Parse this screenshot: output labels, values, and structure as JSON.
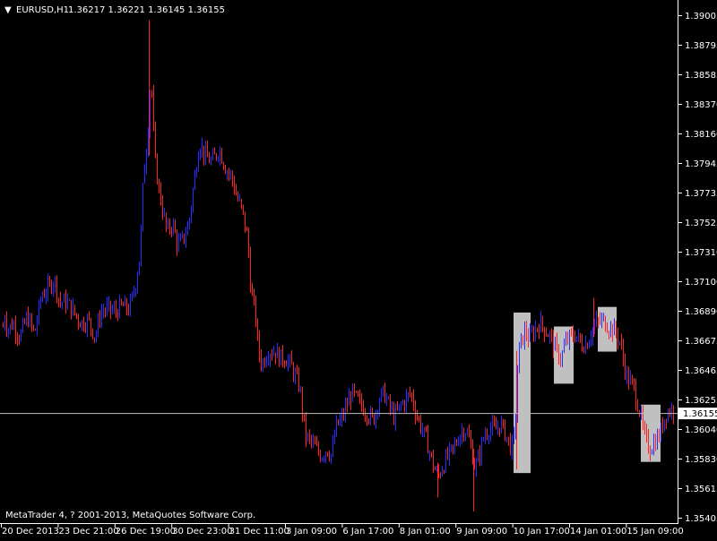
{
  "header": {
    "arrow_glyph": "▼",
    "symbol": "EURUSD,H1",
    "ohlc": "1.36217  1.36221  1.36145  1.36155"
  },
  "price_axis": {
    "labels": [
      "1.39005",
      "1.38795",
      "1.38585",
      "1.38370",
      "1.38160",
      "1.37945",
      "1.37735",
      "1.37525",
      "1.37310",
      "1.37100",
      "1.36890",
      "1.36675",
      "1.36465",
      "1.36255",
      "1.36040",
      "1.35830",
      "1.35615",
      "1.35405"
    ]
  },
  "time_axis": {
    "labels": [
      "20 Dec 2013",
      "23 Dec 21:00",
      "26 Dec 19:00",
      "30 Dec 23:00",
      "31 Dec 11:00",
      "3 Jan 09:00",
      "6 Jan 17:00",
      "8 Jan 01:00",
      "9 Jan 09:00",
      "10 Jan 17:00",
      "14 Jan 01:00",
      "15 Jan 09:00"
    ]
  },
  "bid_line": {
    "price": 1.36155,
    "label": "1.36155"
  },
  "copyright": "MetaTrader 4, ? 2001-2013, MetaQuotes Software Corp.",
  "colors": {
    "background": "#000000",
    "axis": "#ffffff",
    "bull": "#2b2bff",
    "bear": "#ff2222",
    "highlight": "#c0c0c0",
    "bid_line": "#c0c0c0"
  },
  "chart_data": {
    "type": "bar",
    "symbol": "EURUSD",
    "timeframe": "H1",
    "y_range": [
      1.35405,
      1.39005
    ],
    "path_points": [
      [
        0,
        1.364
      ],
      [
        4,
        1.369
      ],
      [
        8,
        1.3675
      ],
      [
        14,
        1.368
      ],
      [
        22,
        1.367
      ],
      [
        30,
        1.3685
      ],
      [
        38,
        1.3672
      ],
      [
        46,
        1.37
      ],
      [
        54,
        1.3705
      ],
      [
        60,
        1.3712
      ],
      [
        66,
        1.3695
      ],
      [
        74,
        1.3695
      ],
      [
        82,
        1.3688
      ],
      [
        90,
        1.368
      ],
      [
        98,
        1.3682
      ],
      [
        106,
        1.367
      ],
      [
        112,
        1.3688
      ],
      [
        120,
        1.369
      ],
      [
        128,
        1.3688
      ],
      [
        136,
        1.3692
      ],
      [
        144,
        1.369
      ],
      [
        150,
        1.3705
      ],
      [
        156,
        1.373
      ],
      [
        160,
        1.379
      ],
      [
        164,
        1.381
      ],
      [
        168,
        1.386
      ],
      [
        172,
        1.38
      ],
      [
        176,
        1.378
      ],
      [
        180,
        1.3765
      ],
      [
        186,
        1.3745
      ],
      [
        192,
        1.3752
      ],
      [
        198,
        1.3735
      ],
      [
        204,
        1.374
      ],
      [
        210,
        1.375
      ],
      [
        216,
        1.378
      ],
      [
        222,
        1.381
      ],
      [
        228,
        1.38
      ],
      [
        236,
        1.3795
      ],
      [
        244,
        1.3805
      ],
      [
        252,
        1.379
      ],
      [
        258,
        1.3785
      ],
      [
        264,
        1.377
      ],
      [
        270,
        1.376
      ],
      [
        276,
        1.374
      ],
      [
        280,
        1.37
      ],
      [
        284,
        1.369
      ],
      [
        288,
        1.366
      ],
      [
        292,
        1.365
      ],
      [
        298,
        1.366
      ],
      [
        306,
        1.366
      ],
      [
        312,
        1.3655
      ],
      [
        318,
        1.3655
      ],
      [
        324,
        1.365
      ],
      [
        330,
        1.364
      ],
      [
        334,
        1.3635
      ],
      [
        340,
        1.36
      ],
      [
        346,
        1.3595
      ],
      [
        352,
        1.359
      ],
      [
        358,
        1.3585
      ],
      [
        364,
        1.359
      ],
      [
        370,
        1.3585
      ],
      [
        374,
        1.3605
      ],
      [
        380,
        1.361
      ],
      [
        386,
        1.362
      ],
      [
        392,
        1.363
      ],
      [
        398,
        1.3625
      ],
      [
        404,
        1.362
      ],
      [
        410,
        1.3615
      ],
      [
        416,
        1.361
      ],
      [
        422,
        1.3625
      ],
      [
        428,
        1.363
      ],
      [
        434,
        1.362
      ],
      [
        440,
        1.3612
      ],
      [
        446,
        1.362
      ],
      [
        452,
        1.3625
      ],
      [
        458,
        1.363
      ],
      [
        464,
        1.3615
      ],
      [
        470,
        1.3605
      ],
      [
        476,
        1.3595
      ],
      [
        482,
        1.358
      ],
      [
        488,
        1.357
      ],
      [
        494,
        1.3578
      ],
      [
        500,
        1.3585
      ],
      [
        506,
        1.359
      ],
      [
        512,
        1.36
      ],
      [
        518,
        1.3605
      ],
      [
        524,
        1.3595
      ],
      [
        530,
        1.3575
      ],
      [
        534,
        1.3585
      ],
      [
        540,
        1.36
      ],
      [
        546,
        1.3605
      ],
      [
        552,
        1.3603
      ],
      [
        558,
        1.3608
      ],
      [
        564,
        1.36
      ],
      [
        570,
        1.359
      ],
      [
        574,
        1.36
      ],
      [
        578,
        1.366
      ],
      [
        582,
        1.3668
      ],
      [
        586,
        1.3675
      ],
      [
        590,
        1.3668
      ],
      [
        596,
        1.3675
      ],
      [
        602,
        1.368
      ],
      [
        608,
        1.3675
      ],
      [
        614,
        1.367
      ],
      [
        620,
        1.366
      ],
      [
        626,
        1.3655
      ],
      [
        630,
        1.3665
      ],
      [
        636,
        1.367
      ],
      [
        642,
        1.3672
      ],
      [
        648,
        1.3665
      ],
      [
        654,
        1.3665
      ],
      [
        660,
        1.3675
      ],
      [
        666,
        1.368
      ],
      [
        672,
        1.3682
      ],
      [
        678,
        1.3678
      ],
      [
        684,
        1.3675
      ],
      [
        688,
        1.3672
      ],
      [
        692,
        1.3665
      ],
      [
        696,
        1.365
      ],
      [
        700,
        1.364
      ],
      [
        706,
        1.3635
      ],
      [
        710,
        1.3625
      ],
      [
        714,
        1.3615
      ],
      [
        718,
        1.36
      ],
      [
        724,
        1.359
      ],
      [
        730,
        1.3595
      ],
      [
        736,
        1.36
      ],
      [
        742,
        1.3615
      ],
      [
        748,
        1.3618
      ],
      [
        752,
        1.3616
      ]
    ],
    "highlight_boxes": [
      {
        "x1": 573,
        "x2": 592,
        "top": 1.36875,
        "bottom": 1.35725
      },
      {
        "x1": 618,
        "x2": 640,
        "top": 1.36775,
        "bottom": 1.36365
      },
      {
        "x1": 667,
        "x2": 688,
        "top": 1.36915,
        "bottom": 1.36595
      },
      {
        "x1": 715,
        "x2": 737,
        "top": 1.36215,
        "bottom": 1.35805
      }
    ],
    "spikes": [
      {
        "x": 166,
        "high": 1.3897,
        "low": 1.38
      },
      {
        "x": 488,
        "high": 1.358,
        "low": 1.3555
      },
      {
        "x": 528,
        "high": 1.359,
        "low": 1.3545
      },
      {
        "x": 662,
        "high": 1.3698,
        "low": 1.367
      },
      {
        "x": 576,
        "high": 1.366,
        "low": 1.3575
      }
    ]
  }
}
